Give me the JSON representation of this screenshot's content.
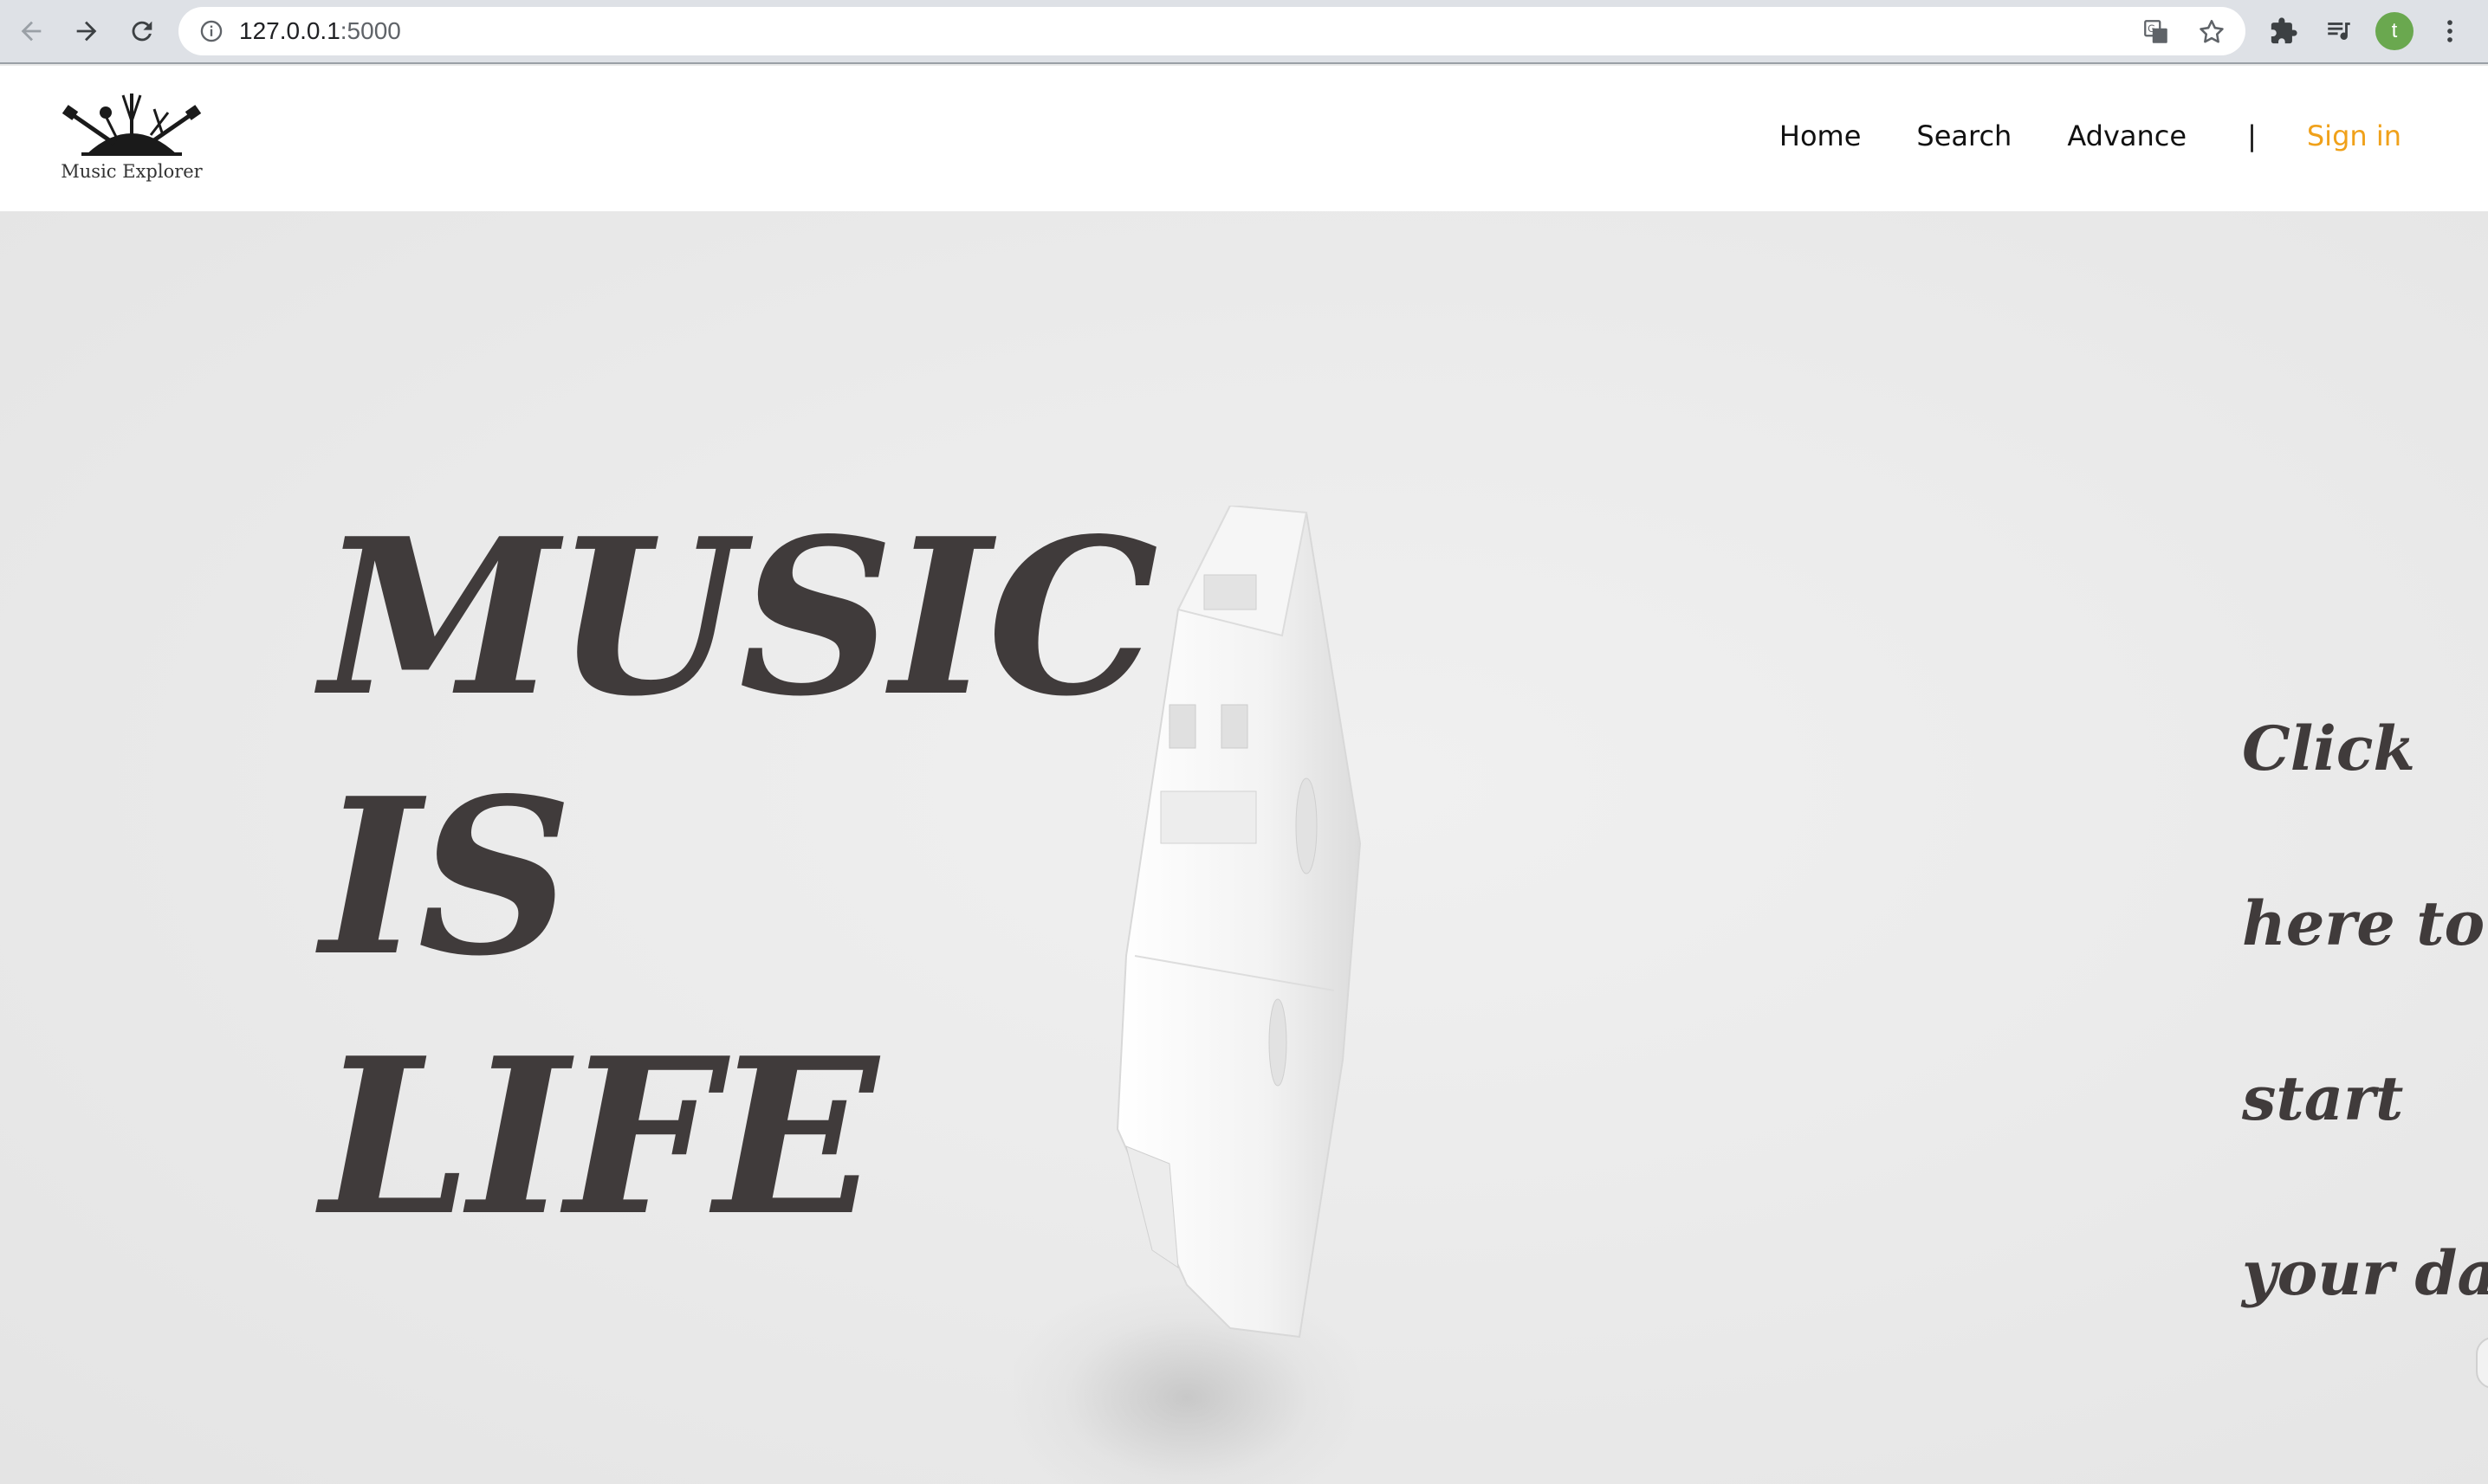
{
  "browser": {
    "url_host": "127.0.0.1",
    "url_port": ":5000",
    "avatar_letter": "t"
  },
  "site": {
    "logo_text": "Music Explorer",
    "nav": {
      "home": "Home",
      "search": "Search",
      "advance": "Advance",
      "separator": "|",
      "signin": "Sign in"
    },
    "colors": {
      "signin": "#f0a11a",
      "hero_text": "#403b3b",
      "avatar": "#6aa84f"
    }
  },
  "hero": {
    "title_lines": [
      "MUSIC",
      "IS",
      "LIFE"
    ],
    "cta_lines": [
      "Click",
      "here to",
      "start",
      "your day"
    ]
  },
  "icons": {
    "back": "back-arrow-icon",
    "forward": "forward-arrow-icon",
    "reload": "reload-icon",
    "info": "info-icon",
    "translate": "translate-icon",
    "bookmark": "star-icon",
    "extensions": "puzzle-icon",
    "media": "playlist-icon",
    "menu": "kebab-menu-icon"
  }
}
